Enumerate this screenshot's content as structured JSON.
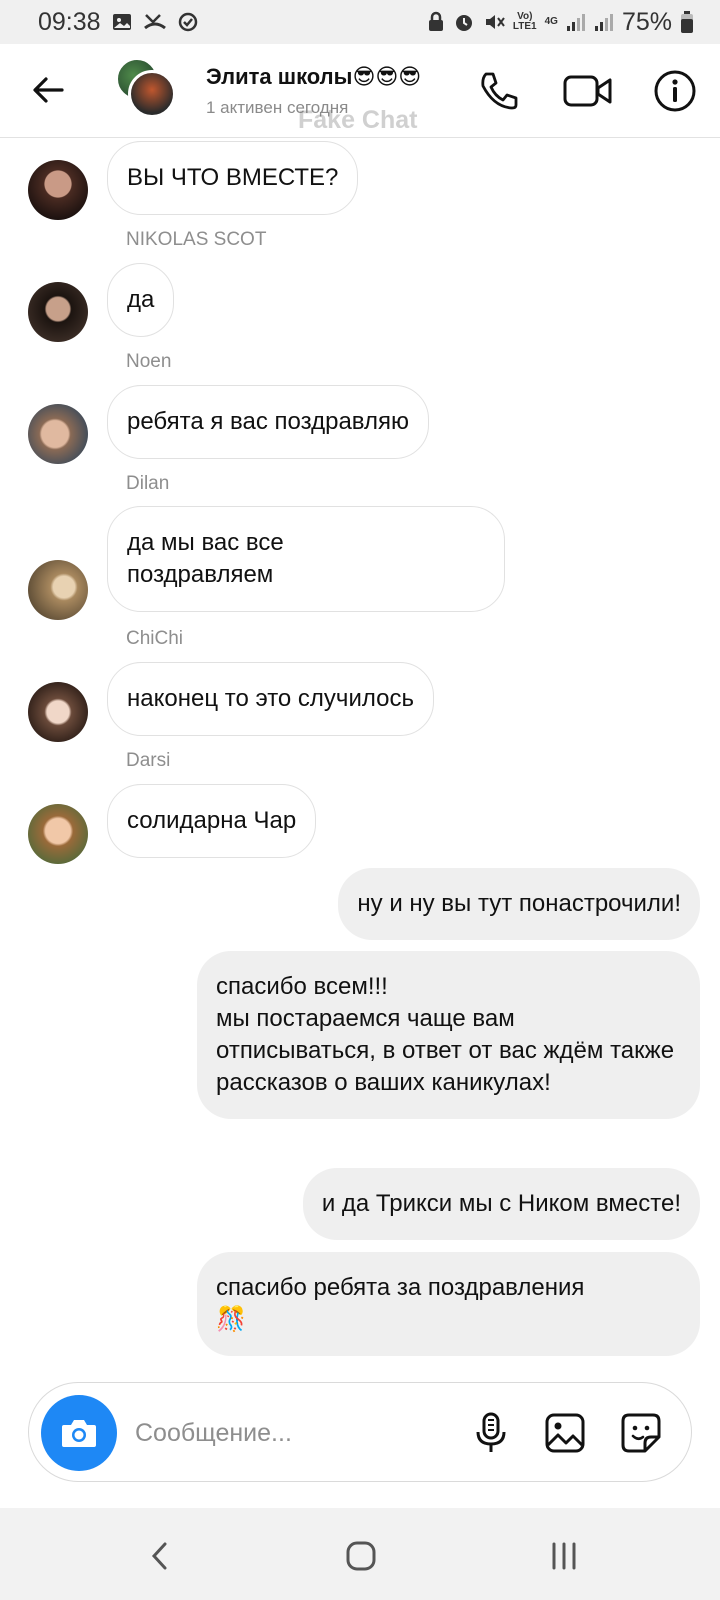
{
  "status_bar": {
    "time": "09:38",
    "network_volte": "Vo)",
    "network_lte": "LTE1",
    "network_4g": "4G",
    "battery": "75%"
  },
  "header": {
    "title": "Элита школы😎😎😎",
    "subtitle": "1 активен сегодня",
    "watermark": "Fake Chat"
  },
  "messages": [
    {
      "text": "ВЫ ЧТО ВМЕСТЕ?",
      "direction": "incoming"
    },
    {
      "sender": "NIKOLAS SCOT",
      "text": "да",
      "direction": "incoming"
    },
    {
      "sender": "Noen",
      "text": "ребята я вас поздравляю",
      "direction": "incoming"
    },
    {
      "sender": "Dilan",
      "text": "да мы вас все\nпоздравляем",
      "direction": "incoming"
    },
    {
      "sender": "ChiChi",
      "text": "наконец то это случилось",
      "direction": "incoming"
    },
    {
      "sender": "Darsi",
      "text": "солидарна Чар",
      "direction": "incoming"
    },
    {
      "text": "ну и ну вы тут понастрочили!",
      "direction": "outgoing"
    },
    {
      "text": "спасибо всем!!!\nмы постараемся чаще вам отписываться, в ответ от вас ждём также рассказов о ваших каникулах!",
      "direction": "outgoing"
    },
    {
      "text": "и да Трикси мы с Ником вместе!",
      "direction": "outgoing"
    },
    {
      "text": "спасибо ребята за поздравления\n🎊",
      "direction": "outgoing"
    }
  ],
  "composer": {
    "placeholder": "Сообщение..."
  },
  "colors": {
    "accent": "#1e88f5",
    "outgoing_bubble": "#efefef",
    "incoming_border": "#e1e1e1",
    "muted_text": "#8e8e8e"
  },
  "icons": {
    "header": [
      "back-arrow-icon",
      "phone-icon",
      "video-camera-icon",
      "info-icon"
    ],
    "composer": [
      "camera-icon",
      "microphone-icon",
      "image-icon",
      "sticker-icon"
    ],
    "nav": [
      "nav-back-icon",
      "nav-home-icon",
      "nav-recents-icon"
    ]
  }
}
